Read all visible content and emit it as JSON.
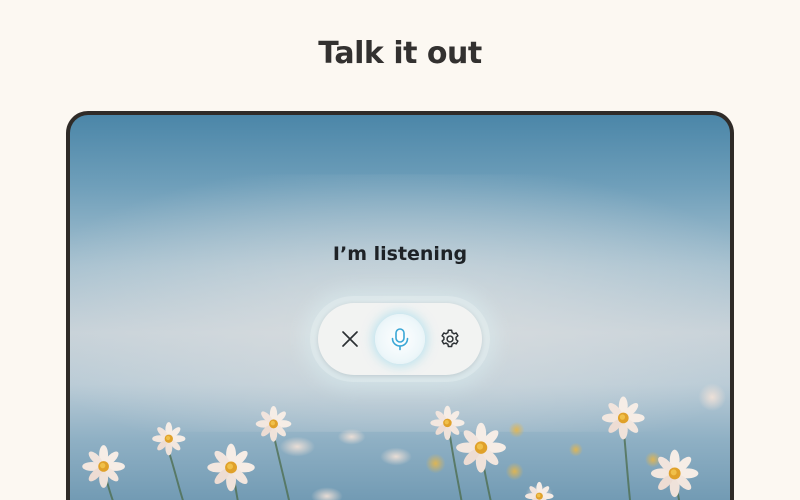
{
  "headline": "Talk it out",
  "status_text": "I’m listening",
  "controls": {
    "close": {
      "icon": "close-icon"
    },
    "mic": {
      "icon": "microphone-icon",
      "accent": "#3aa7d6"
    },
    "settings": {
      "icon": "gear-icon"
    }
  },
  "colors": {
    "page_background": "#fcf8f2",
    "frame": "#2f2b28",
    "sky_top": "#4b86a8",
    "bar_background": "#f2f3f2"
  }
}
